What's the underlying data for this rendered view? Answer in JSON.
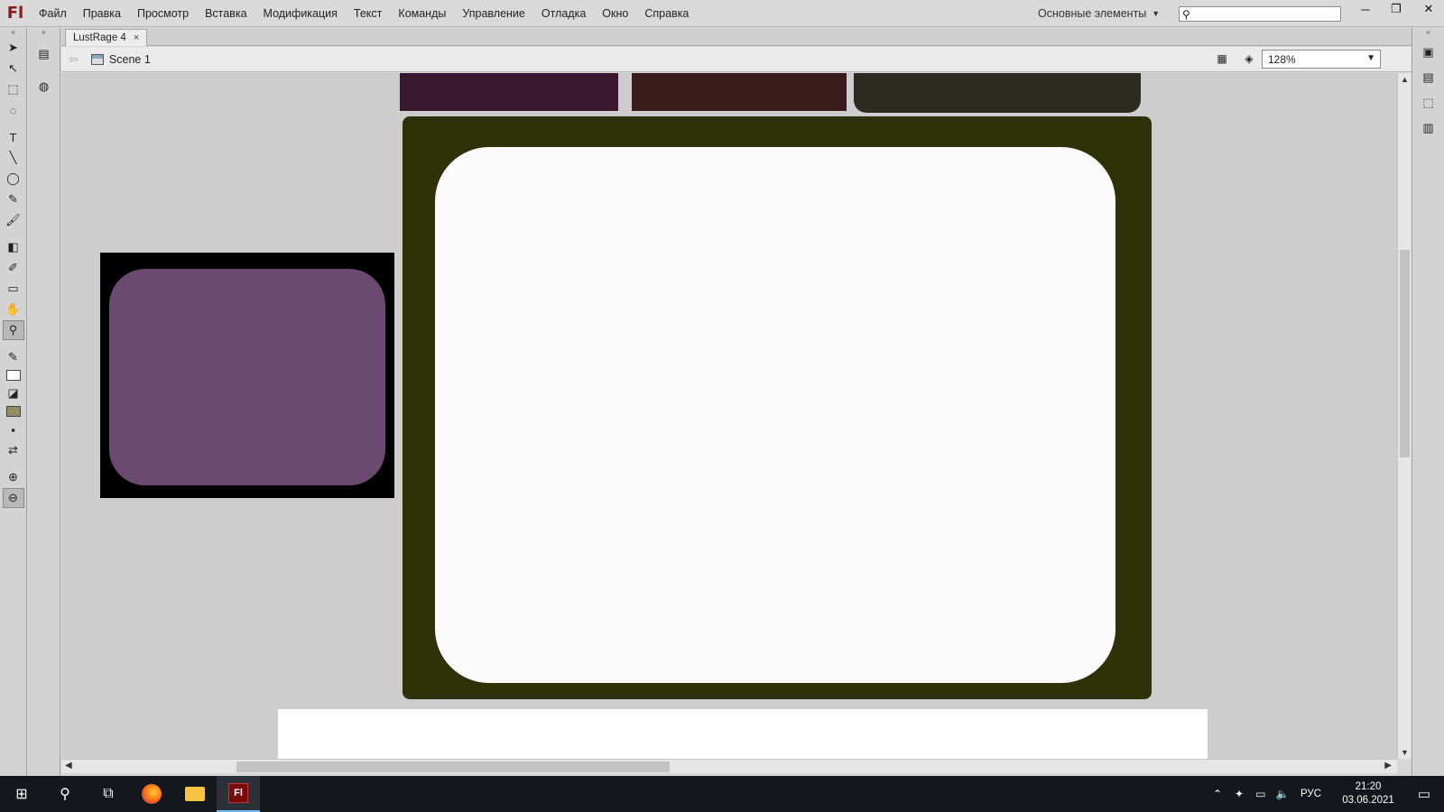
{
  "app": {
    "logo": "Fl"
  },
  "menu": [
    "Файл",
    "Правка",
    "Просмотр",
    "Вставка",
    "Модификация",
    "Текст",
    "Команды",
    "Управление",
    "Отладка",
    "Окно",
    "Справка"
  ],
  "workspace": {
    "label": "Основные элементы"
  },
  "search": {
    "placeholder": "",
    "value": ""
  },
  "document": {
    "tab_label": "LustRage 4",
    "tab_close": "×"
  },
  "edit_bar": {
    "scene": "Scene 1",
    "zoom": "128%"
  },
  "taskbar": {
    "language": "РУС",
    "time": "21:20",
    "date": "03.06.2021"
  },
  "colors": {
    "accent": "#76b9ed",
    "stage": "#cdcdcd",
    "taskbar": "#14171c"
  }
}
